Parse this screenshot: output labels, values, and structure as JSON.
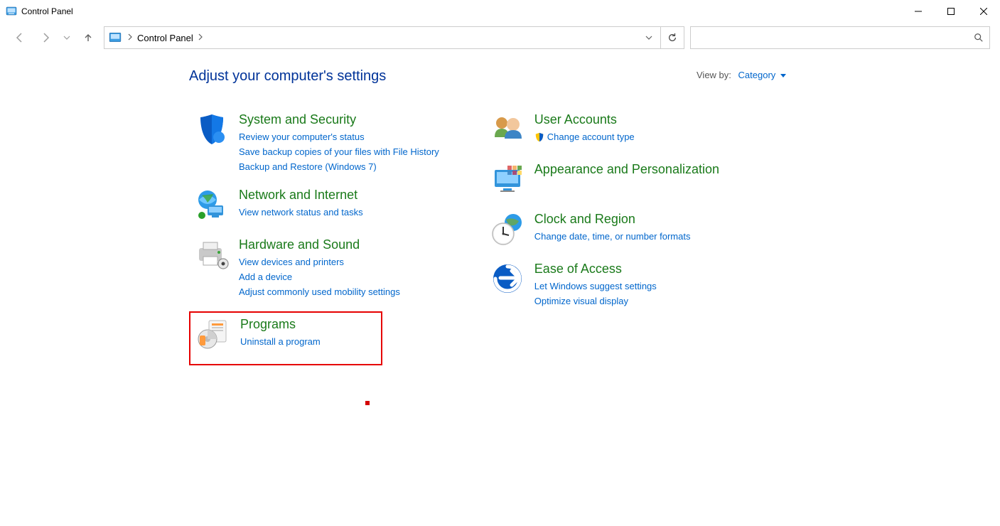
{
  "window": {
    "title": "Control Panel"
  },
  "address": {
    "crumb1": "Control Panel"
  },
  "search": {
    "placeholder": ""
  },
  "heading": "Adjust your computer's settings",
  "viewby": {
    "label": "View by:",
    "value": "Category"
  },
  "catSystem": {
    "title": "System and Security",
    "links": [
      "Review your computer's status",
      "Save backup copies of your files with File History",
      "Backup and Restore (Windows 7)"
    ]
  },
  "catNetwork": {
    "title": "Network and Internet",
    "links": [
      "View network status and tasks"
    ]
  },
  "catHardware": {
    "title": "Hardware and Sound",
    "links": [
      "View devices and printers",
      "Add a device",
      "Adjust commonly used mobility settings"
    ]
  },
  "catPrograms": {
    "title": "Programs",
    "links": [
      "Uninstall a program"
    ]
  },
  "catUsers": {
    "title": "User Accounts",
    "links": [
      "Change account type"
    ]
  },
  "catAppearance": {
    "title": "Appearance and Personalization",
    "links": []
  },
  "catClock": {
    "title": "Clock and Region",
    "links": [
      "Change date, time, or number formats"
    ]
  },
  "catEase": {
    "title": "Ease of Access",
    "links": [
      "Let Windows suggest settings",
      "Optimize visual display"
    ]
  }
}
